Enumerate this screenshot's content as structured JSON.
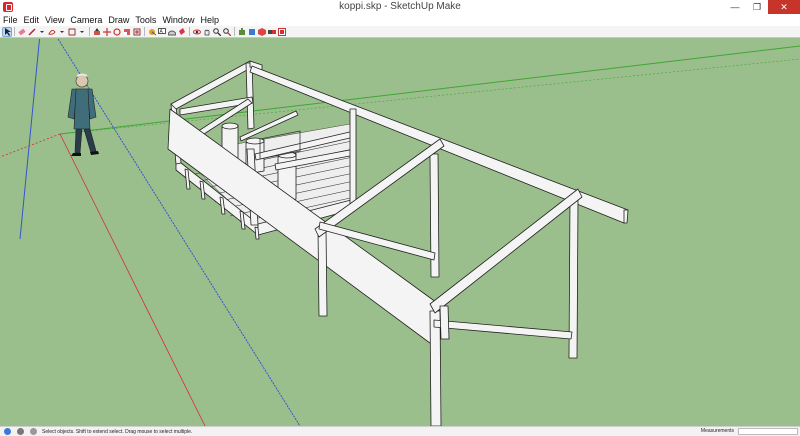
{
  "window": {
    "title": "koppi.skp - SketchUp Make",
    "minimize": "—",
    "restore": "❐",
    "close": "✕"
  },
  "menu": [
    "File",
    "Edit",
    "View",
    "Camera",
    "Draw",
    "Tools",
    "Window",
    "Help"
  ],
  "toolbar": {
    "icons": [
      "select-icon",
      "eraser-icon",
      "line-icon",
      "line-dropdown-icon",
      "shape-icon",
      "shape-dropdown-icon",
      "rectangle-icon",
      "rectangle-dropdown-icon",
      "push-pull-icon",
      "move-icon",
      "rotate-icon",
      "scale-icon",
      "offset-icon",
      "tape-measure-icon",
      "text-icon",
      "protractor-icon",
      "paint-bucket-icon",
      "orbit-icon",
      "pan-icon",
      "zoom-icon",
      "zoom-extents-icon",
      "warehouse-icon",
      "extension-warehouse-icon",
      "components-icon",
      "styles-icon",
      "layout-icon"
    ]
  },
  "status": {
    "text": "Select objects. Shift to extend select. Drag mouse to select multiple.",
    "measurements_label": "Measurements",
    "measurements_value": ""
  },
  "colors": {
    "background": "#9bbf8c",
    "structure_fill": "#f4f4f4",
    "structure_edge": "#222222",
    "axis_green": "#3fa535",
    "axis_blue": "#3355cc",
    "axis_red": "#cc3333"
  }
}
